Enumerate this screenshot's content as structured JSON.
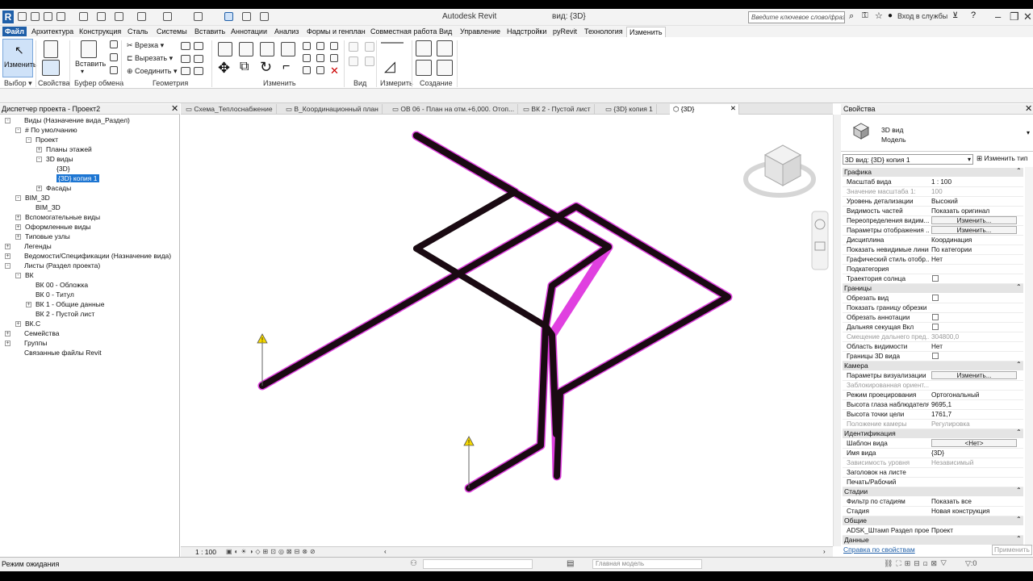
{
  "app": {
    "name": "Autodesk Revit",
    "document": "вид: {3D}",
    "search_placeholder": "Введите ключевое слово/фразу",
    "login": "Вход в службы"
  },
  "menu_tabs": [
    "Файл",
    "Архитектура",
    "Конструкция",
    "Сталь",
    "Системы",
    "Вставить",
    "Аннотации",
    "Анализ",
    "Формы и генплан",
    "Совместная работа",
    "Вид",
    "Управление",
    "Надстройки",
    "pyRevit",
    "Технология",
    "Изменить"
  ],
  "ribbon": {
    "modify_label": "Изменить",
    "paste_label": "Вставить",
    "cut_label": "Врезка",
    "cutout_label": "Вырезать",
    "join_label": "Соединить",
    "groups": [
      "Выбор",
      "Свойства",
      "Буфер обмена",
      "Геометрия",
      "Изменить",
      "Вид",
      "Измерить",
      "Создание"
    ]
  },
  "project_browser": {
    "title": "Диспетчер проекта - Проект2",
    "items": [
      {
        "label": "Виды (Назначение вида_Раздел)",
        "level": 0,
        "exp": "-"
      },
      {
        "label": "# По умолчанию",
        "level": 1,
        "exp": "-"
      },
      {
        "label": "Проект",
        "level": 2,
        "exp": "-"
      },
      {
        "label": "Планы этажей",
        "level": 3,
        "exp": "+"
      },
      {
        "label": "3D виды",
        "level": 3,
        "exp": "-"
      },
      {
        "label": "{3D}",
        "level": 4,
        "exp": ""
      },
      {
        "label": "{3D} копия 1",
        "level": 4,
        "exp": "",
        "selected": true
      },
      {
        "label": "Фасады",
        "level": 3,
        "exp": "+"
      },
      {
        "label": "BIM_3D",
        "level": 1,
        "exp": "-"
      },
      {
        "label": "BIM_3D",
        "level": 2,
        "exp": ""
      },
      {
        "label": "Вспомогательные виды",
        "level": 1,
        "exp": "+"
      },
      {
        "label": "Оформленные виды",
        "level": 1,
        "exp": "+"
      },
      {
        "label": "Типовые узлы",
        "level": 1,
        "exp": "+"
      },
      {
        "label": "Легенды",
        "level": 0,
        "exp": "+"
      },
      {
        "label": "Ведомости/Спецификации (Назначение вида)",
        "level": 0,
        "exp": "+"
      },
      {
        "label": "Листы (Раздел проекта)",
        "level": 0,
        "exp": "-"
      },
      {
        "label": "ВК",
        "level": 1,
        "exp": "-"
      },
      {
        "label": "ВК 00 - Обложка",
        "level": 2,
        "exp": ""
      },
      {
        "label": "ВК 0 - Титул",
        "level": 2,
        "exp": ""
      },
      {
        "label": "ВК 1 - Общие данные",
        "level": 2,
        "exp": "+"
      },
      {
        "label": "ВК 2 - Пустой лист",
        "level": 2,
        "exp": ""
      },
      {
        "label": "ВК.С",
        "level": 1,
        "exp": "+"
      },
      {
        "label": "Семейства",
        "level": 0,
        "exp": "+"
      },
      {
        "label": "Группы",
        "level": 0,
        "exp": "+"
      },
      {
        "label": "Связанные файлы Revit",
        "level": 0,
        "exp": ""
      }
    ]
  },
  "view_tabs": [
    "Схема_Теплоснабжение",
    "В_Координационный план",
    "ОВ 06 - План на отм.+6,000. Отоп...",
    "ВК 2 - Пустой лист",
    "{3D} копия 1",
    "{3D}"
  ],
  "view_scale": "1 : 100",
  "status": "Режим ожидания",
  "model_box": "Главная модель",
  "properties": {
    "title": "Свойства",
    "type_line1": "3D вид",
    "type_line2": "Модель",
    "selector": "3D вид: {3D} копия 1",
    "edit_type": "Изменить тип",
    "help": "Справка по свойствам",
    "apply": "Применить",
    "rows": [
      {
        "kind": "cat",
        "name": "Графика"
      },
      {
        "kind": "val",
        "name": "Масштаб вида",
        "value": "1 : 100"
      },
      {
        "kind": "val",
        "name": "Значение масштаба   1:",
        "value": "100",
        "dim": true
      },
      {
        "kind": "val",
        "name": "Уровень детализации",
        "value": "Высокий"
      },
      {
        "kind": "val",
        "name": "Видимость частей",
        "value": "Показать оригинал"
      },
      {
        "kind": "btn",
        "name": "Переопределения видим...",
        "value": "Изменить..."
      },
      {
        "kind": "btn",
        "name": "Параметры отображения ...",
        "value": "Изменить..."
      },
      {
        "kind": "val",
        "name": "Дисциплина",
        "value": "Координация"
      },
      {
        "kind": "val",
        "name": "Показать невидимые линии",
        "value": "По категории"
      },
      {
        "kind": "val",
        "name": "Графический стиль отобр...",
        "value": "Нет"
      },
      {
        "kind": "val",
        "name": "Подкатегория",
        "value": ""
      },
      {
        "kind": "chk",
        "name": "Траектория солнца"
      },
      {
        "kind": "cat",
        "name": "Границы"
      },
      {
        "kind": "chk",
        "name": "Обрезать вид"
      },
      {
        "kind": "val",
        "name": "Показать границу обрезки",
        "value": ""
      },
      {
        "kind": "chk",
        "name": "Обрезать аннотации"
      },
      {
        "kind": "chk",
        "name": "Дальняя секущая Вкл"
      },
      {
        "kind": "val",
        "name": "Смещение дальнего пред...",
        "value": "304800,0",
        "dim": true
      },
      {
        "kind": "val",
        "name": "Область видимости",
        "value": "Нет"
      },
      {
        "kind": "chk",
        "name": "Границы 3D вида"
      },
      {
        "kind": "cat",
        "name": "Камера"
      },
      {
        "kind": "btn",
        "name": "Параметры визуализации",
        "value": "Изменить..."
      },
      {
        "kind": "val",
        "name": "Заблокированная ориент...",
        "value": "",
        "dim": true
      },
      {
        "kind": "val",
        "name": "Режим проецирования",
        "value": "Ортогональный"
      },
      {
        "kind": "val",
        "name": "Высота глаза наблюдателя",
        "value": "9695,1"
      },
      {
        "kind": "val",
        "name": "Высота точки цели",
        "value": "1761,7"
      },
      {
        "kind": "val",
        "name": "Положение камеры",
        "value": "Регулировка",
        "dim": true
      },
      {
        "kind": "cat",
        "name": "Идентификация"
      },
      {
        "kind": "btn",
        "name": "Шаблон вида",
        "value": "<Нет>"
      },
      {
        "kind": "val",
        "name": "Имя вида",
        "value": "{3D}"
      },
      {
        "kind": "val",
        "name": "Зависимость уровня",
        "value": "Независимый",
        "dim": true
      },
      {
        "kind": "val",
        "name": "Заголовок на листе",
        "value": ""
      },
      {
        "kind": "val",
        "name": "Печать/Рабочий",
        "value": ""
      },
      {
        "kind": "cat",
        "name": "Стадии"
      },
      {
        "kind": "val",
        "name": "Фильтр по стадиям",
        "value": "Показать все"
      },
      {
        "kind": "val",
        "name": "Стадия",
        "value": "Новая конструкция"
      },
      {
        "kind": "cat",
        "name": "Общие"
      },
      {
        "kind": "val",
        "name": "ADSK_Штамп Раздел прое...",
        "value": "Проект"
      },
      {
        "kind": "cat",
        "name": "Данные"
      }
    ]
  },
  "colors": {
    "accent": "#1f5fa8",
    "pipe": "#1a0a12",
    "pipe_edge": "#e040e0"
  }
}
